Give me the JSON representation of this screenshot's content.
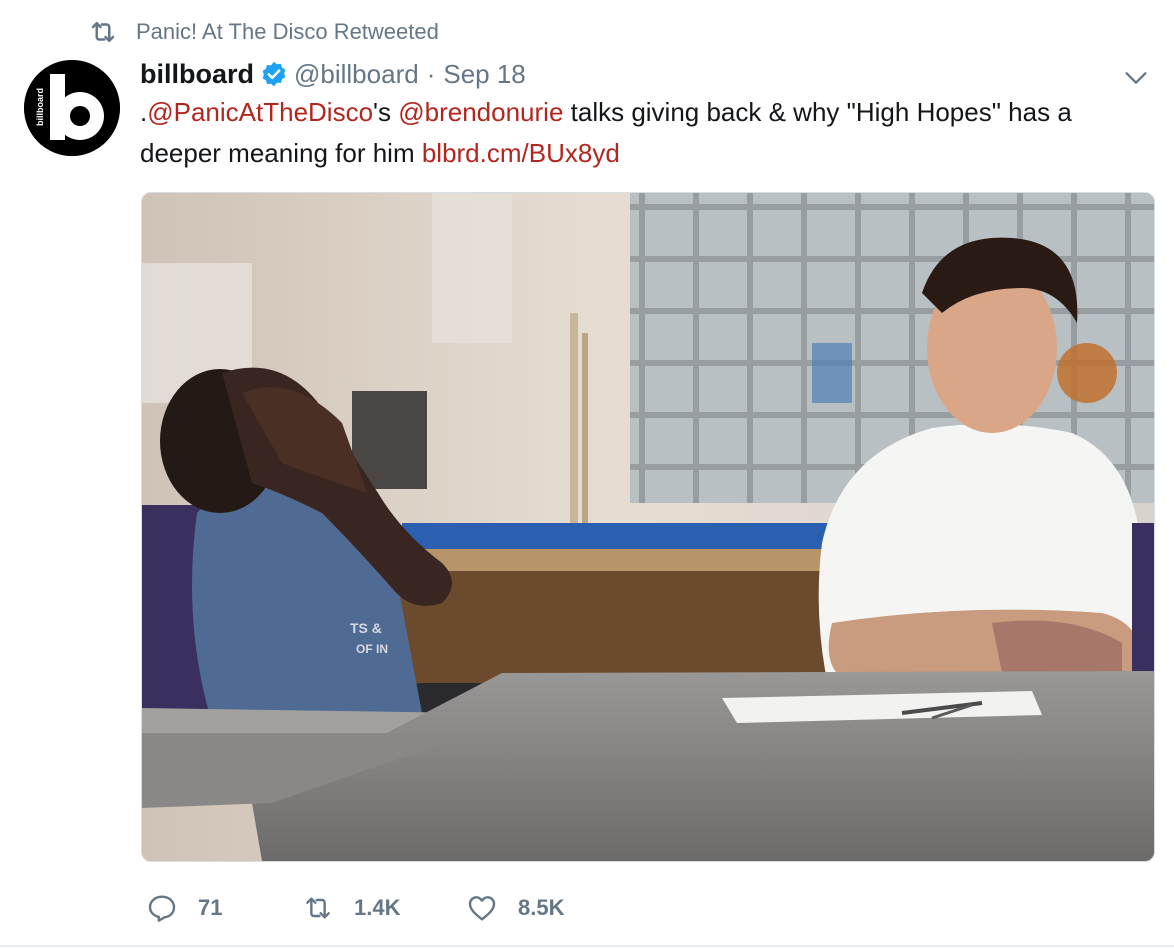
{
  "retweet_context": {
    "label": "Panic! At The Disco Retweeted",
    "icon": "retweet-icon"
  },
  "author": {
    "name": "billboard",
    "handle": "@billboard",
    "separator": "·",
    "time": "Sep 18",
    "verified": true,
    "avatar_icon": "billboard-logo",
    "avatar_wordmark": "billboard",
    "avatar_letter": "b"
  },
  "tweet": {
    "prefix": ".",
    "mention_1": "@PanicAtTheDisco",
    "mid_1": "'s ",
    "mention_2": "@brendonurie",
    "body": " talks giving back & why \"High Hopes\" has a deeper meaning for him ",
    "link": "blbrd.cm/BUx8yd"
  },
  "media": {
    "kind": "photo",
    "subject": "man-in-white-shirt-smiling-at-boy-covering-face",
    "shirt_text_1": "TS &",
    "shirt_text_2": "OF IN"
  },
  "actions": {
    "reply_count": "71",
    "retweet_count": "1.4K",
    "like_count": "8.5K"
  },
  "colors": {
    "link": "#b3261e",
    "muted": "#657786",
    "verified": "#1da1f2"
  }
}
